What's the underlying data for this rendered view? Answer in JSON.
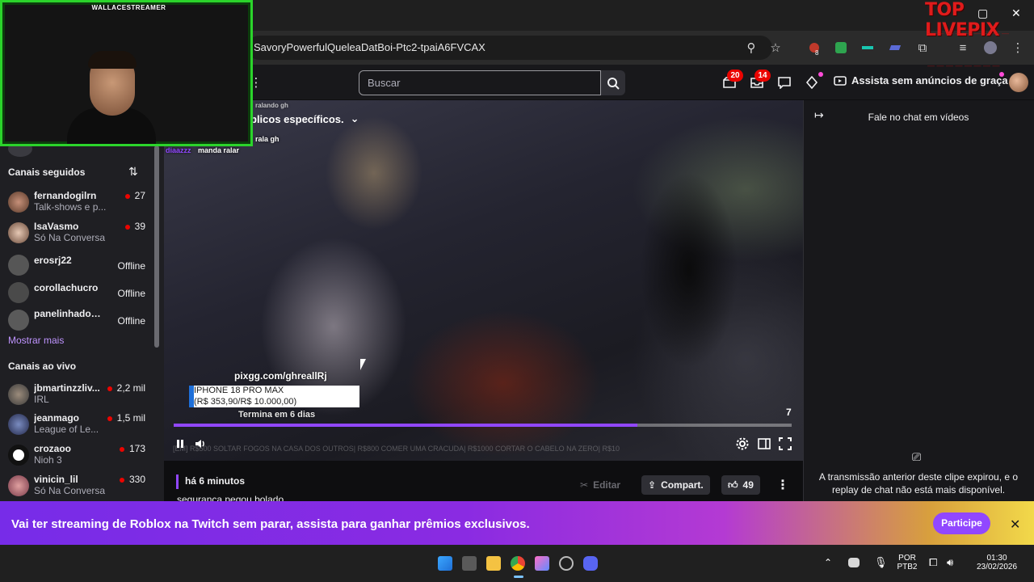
{
  "browser": {
    "url_text": "SavoryPowerfulQueleaDatBoi-Ptc2-tpaiA6FVCAX",
    "extension_badge": "8"
  },
  "twitch_nav": {
    "search_placeholder": "Buscar",
    "notifications_badge": "20",
    "inbox_badge": "14",
    "ad_free_label": "Assista sem anúncios de graça"
  },
  "sidebar": {
    "followed_heading": "Canais seguidos",
    "followed": [
      {
        "name": "fernandogilrn",
        "sub": "Talk-shows e p...",
        "count": "27"
      },
      {
        "name": "IsaVasmo",
        "sub": "Só Na Conversa",
        "count": "39"
      },
      {
        "name": "erosrj22",
        "status": "Offline"
      },
      {
        "name": "corollachucro",
        "status": "Offline"
      },
      {
        "name": "panelinhadosa...",
        "status": "Offline"
      }
    ],
    "show_more": "Mostrar mais",
    "live_heading": "Canais ao vivo",
    "live": [
      {
        "name": "jbmartinzzliv...",
        "sub": "IRL",
        "count": "2,2 mil"
      },
      {
        "name": "jeanmago",
        "sub": "League of Le...",
        "count": "1,5 mil"
      },
      {
        "name": "crozaoo",
        "sub": "Nioh 3",
        "count": "173"
      },
      {
        "name": "vinicin_lil",
        "sub": "Só Na Conversa",
        "count": "330"
      }
    ]
  },
  "player": {
    "filter_label": "blicos específicos.",
    "overlay_line1": "ralando gh",
    "overlay_line2": "rala gh",
    "overlay_user": "diaazzz",
    "overlay_msg": "manda ralar",
    "pix_link": "pixgg.com/ghreallRj",
    "pix_line1": "IPHONE 18 PRO MAX",
    "pix_line2": "(R$ 353,90/R$ 10.000,00)",
    "pix_end": "Termina em 6 dias",
    "chip_count": "7",
    "progress": 0.75,
    "ticker": "[EM] R$500 SOLTAR FOGOS NA CASA DOS OUTROS| R$800 COMER UMA CRACUDA| R$1000 CORTAR O CABELO NA ZERO| R$10"
  },
  "clip_info": {
    "time_ago": "há 6 minutos",
    "title": "segurança pegou bolado",
    "edit_label": "Editar",
    "share_label": "Compart.",
    "likes": "49"
  },
  "chat": {
    "title": "Fale no chat em vídeos",
    "expired_message": "A transmissão anterior deste clipe expirou, e o replay de chat não está mais disponível."
  },
  "promo": {
    "text": "Vai ter streaming de Roblox na Twitch sem parar, assista para ganhar prêmios exclusivos.",
    "button": "Participe"
  },
  "taskbar": {
    "lang_line1": "POR",
    "lang_line2": "PTB2",
    "time": "01:30",
    "date": "23/02/2026"
  },
  "overlays": {
    "webcam_label": "WALLACESTREAMER",
    "livepix_title": "TOP LIVEPIX"
  },
  "colors": {
    "twitch_purple": "#9147ff",
    "live_red": "#eb0400",
    "webcam_border": "#2bd42b"
  }
}
